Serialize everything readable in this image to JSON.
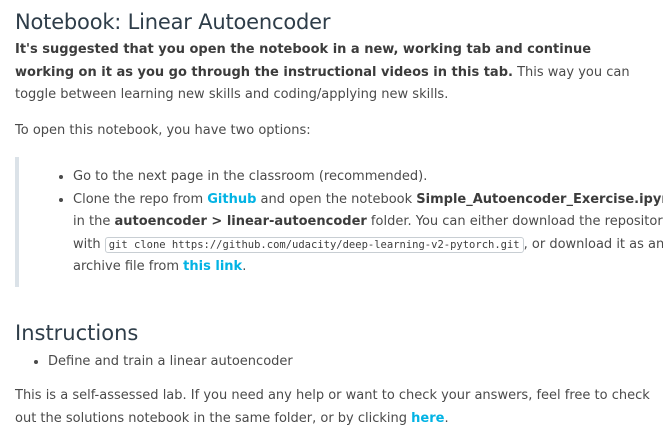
{
  "header": {
    "title": "Notebook: Linear Autoencoder"
  },
  "intro": {
    "bold_text": "It's suggested that you open the notebook in a new, working tab and continue working on it as you go through the instructional videos in this tab.",
    "rest_text": " This way you can toggle between learning new skills and coding/applying new skills."
  },
  "options_intro": "To open this notebook, you have two options:",
  "options": {
    "item1": "Go to the next page in the classroom (recommended).",
    "item2": {
      "t1": "Clone the repo from ",
      "github_link": "Github",
      "t2": " and open the notebook ",
      "notebook_name": "Simple_Autoencoder_Exercise.ipynb",
      "t3": " in the ",
      "folder_name": "autoencoder > linear-autoencoder",
      "t4": " folder. You can either download the repository with ",
      "git_command": "git clone https://github.com/udacity/deep-learning-v2-pytorch.git",
      "t5": ", or download it as an archive file from ",
      "archive_link": "this link",
      "t6": "."
    }
  },
  "instructions": {
    "heading": "Instructions",
    "items": [
      "Define and train a linear autoencoder"
    ]
  },
  "footer": {
    "t1": "This is a self-assessed lab. If you need any help or want to check your answers, feel free to check out the solutions notebook in the same folder, or by clicking ",
    "here_link": "here",
    "t2": "."
  },
  "colors": {
    "heading": "#2e3d49",
    "body_text": "#4a4a4a",
    "link": "#02b3e4",
    "quote_border": "#dbe2e8"
  }
}
